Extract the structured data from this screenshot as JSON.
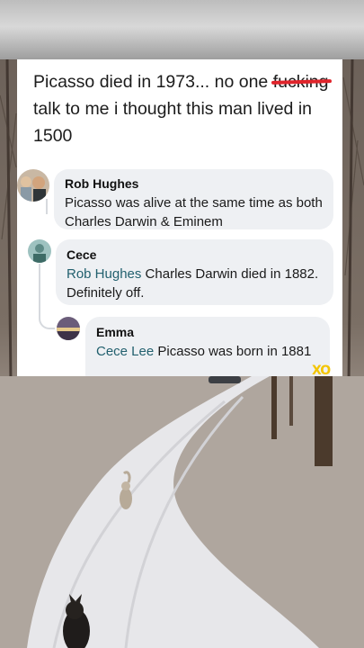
{
  "post": {
    "text_before": "Picasso died in 1973... no one ",
    "censored_word": "fucking",
    "text_after": " talk to me i thought this man lived in 1500"
  },
  "comments": [
    {
      "author": "Rob Hughes",
      "mention": "",
      "text": "Picasso was alive at the same time as both Charles Darwin & Eminem"
    },
    {
      "author": "Cece",
      "mention": "Rob Hughes",
      "text": " Charles Darwin died in 1882. Definitely off."
    },
    {
      "author": "Emma",
      "mention": "Cece Lee",
      "text": " Picasso was born in 1881"
    }
  ],
  "watermark": "XO",
  "colors": {
    "censor_bar": "#e0242b",
    "mention": "#22606e",
    "bubble": "#eef0f3"
  }
}
